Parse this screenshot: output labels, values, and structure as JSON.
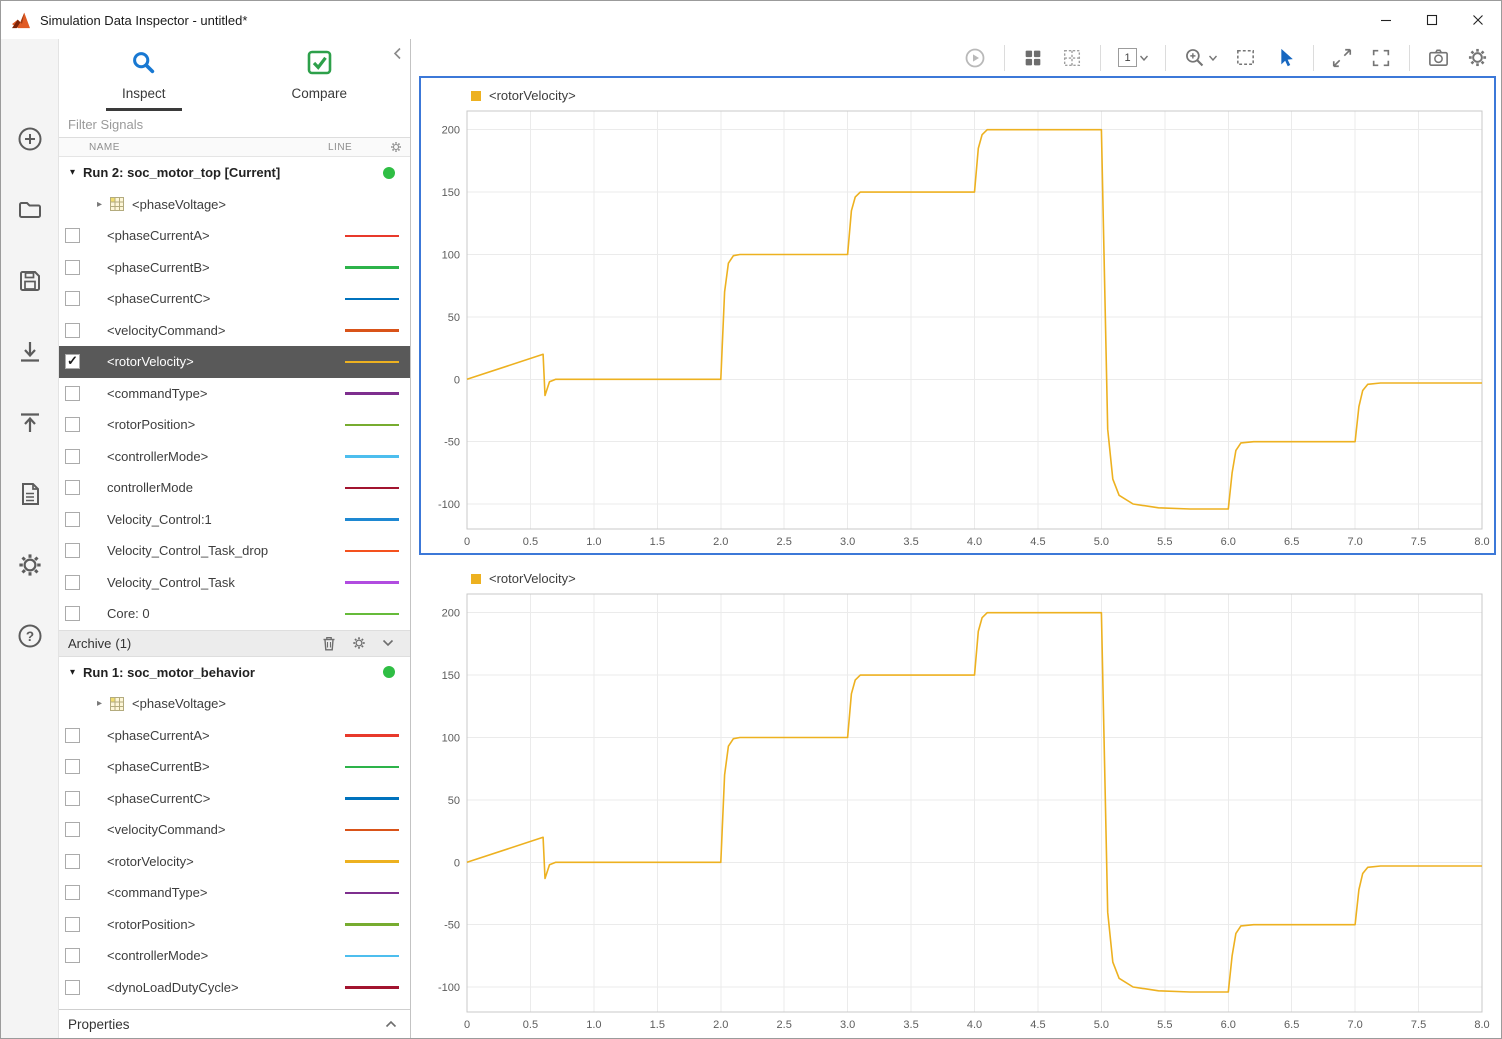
{
  "window": {
    "title": "Simulation Data Inspector - untitled*",
    "controls": [
      "minimize-icon",
      "maximize-icon",
      "close-icon"
    ]
  },
  "left_toolbar": {
    "icons": [
      "add-icon",
      "open-folder-icon",
      "save-icon",
      "import-icon",
      "export-icon",
      "report-icon",
      "preferences-gear-icon",
      "help-icon"
    ]
  },
  "sidebar": {
    "tabs": [
      {
        "label": "Inspect",
        "icon": "magnifier-icon",
        "active": true
      },
      {
        "label": "Compare",
        "icon": "green-check-icon",
        "active": false
      }
    ],
    "filter_placeholder": "Filter Signals",
    "columns": {
      "name": "NAME",
      "line": "LINE"
    },
    "runs": [
      {
        "title": "Run 2: soc_motor_top [Current]",
        "status_color": "#2fbe44",
        "children": [
          {
            "type": "group",
            "label": "<phaseVoltage>"
          },
          {
            "type": "signal",
            "label": "<phaseCurrentA>",
            "color": "#e8392b",
            "checked": false,
            "selected": false
          },
          {
            "type": "signal",
            "label": "<phaseCurrentB>",
            "color": "#2db34a",
            "checked": false,
            "selected": false
          },
          {
            "type": "signal",
            "label": "<phaseCurrentC>",
            "color": "#0072bd",
            "checked": false,
            "selected": false
          },
          {
            "type": "signal",
            "label": "<velocityCommand>",
            "color": "#d95319",
            "checked": false,
            "selected": false
          },
          {
            "type": "signal",
            "label": "<rotorVelocity>",
            "color": "#edb120",
            "checked": true,
            "selected": true
          },
          {
            "type": "signal",
            "label": "<commandType>",
            "color": "#7e2f8e",
            "checked": false,
            "selected": false
          },
          {
            "type": "signal",
            "label": "<rotorPosition>",
            "color": "#77ac30",
            "checked": false,
            "selected": false
          },
          {
            "type": "signal",
            "label": "<controllerMode>",
            "color": "#4dbeee",
            "checked": false,
            "selected": false
          },
          {
            "type": "signal",
            "label": "controllerMode",
            "color": "#a2142f",
            "checked": false,
            "selected": false
          },
          {
            "type": "signal",
            "label": "Velocity_Control:1",
            "color": "#1e88d2",
            "checked": false,
            "selected": false
          },
          {
            "type": "signal",
            "label": "Velocity_Control_Task_drop",
            "color": "#f4511e",
            "checked": false,
            "selected": false
          },
          {
            "type": "signal",
            "label": "Velocity_Control_Task",
            "color": "#b14ce0",
            "checked": false,
            "selected": false
          },
          {
            "type": "signal",
            "label": "Core: 0",
            "color": "#66bb3a",
            "checked": false,
            "selected": false
          }
        ]
      },
      {
        "title": "Run 1: soc_motor_behavior",
        "status_color": "#2fbe44",
        "children": [
          {
            "type": "group",
            "label": "<phaseVoltage>"
          },
          {
            "type": "signal",
            "label": "<phaseCurrentA>",
            "color": "#e8392b",
            "checked": false,
            "selected": false
          },
          {
            "type": "signal",
            "label": "<phaseCurrentB>",
            "color": "#2db34a",
            "checked": false,
            "selected": false
          },
          {
            "type": "signal",
            "label": "<phaseCurrentC>",
            "color": "#0072bd",
            "checked": false,
            "selected": false
          },
          {
            "type": "signal",
            "label": "<velocityCommand>",
            "color": "#d95319",
            "checked": false,
            "selected": false
          },
          {
            "type": "signal",
            "label": "<rotorVelocity>",
            "color": "#edb120",
            "checked": false,
            "selected": false
          },
          {
            "type": "signal",
            "label": "<commandType>",
            "color": "#7e2f8e",
            "checked": false,
            "selected": false
          },
          {
            "type": "signal",
            "label": "<rotorPosition>",
            "color": "#77ac30",
            "checked": false,
            "selected": false
          },
          {
            "type": "signal",
            "label": "<controllerMode>",
            "color": "#4dbeee",
            "checked": false,
            "selected": false
          },
          {
            "type": "signal",
            "label": "<dynoLoadDutyCycle>",
            "color": "#a2142f",
            "checked": false,
            "selected": false
          }
        ]
      }
    ],
    "archive": {
      "label": "Archive",
      "count": "(1)",
      "icons": [
        "trash-icon",
        "gear-icon",
        "chevron-down-icon"
      ]
    },
    "properties_label": "Properties"
  },
  "chart_toolbar": {
    "subplot_number": "1",
    "icons": [
      "replay-icon",
      "layout-grid-icon",
      "subplot-grid-icon",
      "subplot-selector",
      "zoom-icon",
      "zoom-region-icon",
      "pointer-icon",
      "fit-to-view-icon",
      "fullscreen-icon",
      "snapshot-camera-icon",
      "settings-gear-icon"
    ]
  },
  "chart_data": [
    {
      "type": "line",
      "title": "",
      "xlabel": "",
      "ylabel": "",
      "legend": [
        {
          "label": "<rotorVelocity>",
          "color": "#edb120"
        }
      ],
      "legend_position": "top-left",
      "grid": true,
      "selected": true,
      "xlim": [
        0,
        8
      ],
      "ylim": [
        -120,
        215
      ],
      "xticks": [
        0,
        0.5,
        1.0,
        1.5,
        2.0,
        2.5,
        3.0,
        3.5,
        4.0,
        4.5,
        5.0,
        5.5,
        6.0,
        6.5,
        7.0,
        7.5,
        8.0
      ],
      "yticks": [
        -100,
        -50,
        0,
        50,
        100,
        150,
        200
      ],
      "series": [
        {
          "name": "<rotorVelocity>",
          "color": "#edb120",
          "points": [
            [
              0,
              0
            ],
            [
              0.6,
              20
            ],
            [
              0.615,
              -13
            ],
            [
              0.65,
              -2
            ],
            [
              0.7,
              0
            ],
            [
              2,
              0
            ],
            [
              2.03,
              70
            ],
            [
              2.06,
              93
            ],
            [
              2.1,
              99
            ],
            [
              2.15,
              100
            ],
            [
              3,
              100
            ],
            [
              3.03,
              135
            ],
            [
              3.06,
              146
            ],
            [
              3.1,
              150
            ],
            [
              4,
              150
            ],
            [
              4.03,
              185
            ],
            [
              4.06,
              196
            ],
            [
              4.1,
              200
            ],
            [
              5,
              200
            ],
            [
              5.05,
              -40
            ],
            [
              5.09,
              -80
            ],
            [
              5.14,
              -93
            ],
            [
              5.25,
              -100
            ],
            [
              5.45,
              -103
            ],
            [
              5.7,
              -104
            ],
            [
              6,
              -104
            ],
            [
              6.03,
              -75
            ],
            [
              6.06,
              -57
            ],
            [
              6.1,
              -51
            ],
            [
              6.2,
              -50
            ],
            [
              7,
              -50
            ],
            [
              7.03,
              -22
            ],
            [
              7.06,
              -9
            ],
            [
              7.1,
              -4
            ],
            [
              7.2,
              -3
            ],
            [
              8,
              -3
            ]
          ]
        }
      ]
    },
    {
      "type": "line",
      "title": "",
      "xlabel": "",
      "ylabel": "",
      "legend": [
        {
          "label": "<rotorVelocity>",
          "color": "#edb120"
        }
      ],
      "legend_position": "top-left",
      "grid": true,
      "selected": false,
      "xlim": [
        0,
        8
      ],
      "ylim": [
        -120,
        215
      ],
      "xticks": [
        0,
        0.5,
        1.0,
        1.5,
        2.0,
        2.5,
        3.0,
        3.5,
        4.0,
        4.5,
        5.0,
        5.5,
        6.0,
        6.5,
        7.0,
        7.5,
        8.0
      ],
      "yticks": [
        -100,
        -50,
        0,
        50,
        100,
        150,
        200
      ],
      "series": [
        {
          "name": "<rotorVelocity>",
          "color": "#edb120",
          "points": [
            [
              0,
              0
            ],
            [
              0.6,
              20
            ],
            [
              0.615,
              -13
            ],
            [
              0.65,
              -2
            ],
            [
              0.7,
              0
            ],
            [
              2,
              0
            ],
            [
              2.03,
              70
            ],
            [
              2.06,
              93
            ],
            [
              2.1,
              99
            ],
            [
              2.15,
              100
            ],
            [
              3,
              100
            ],
            [
              3.03,
              135
            ],
            [
              3.06,
              146
            ],
            [
              3.1,
              150
            ],
            [
              4,
              150
            ],
            [
              4.03,
              185
            ],
            [
              4.06,
              196
            ],
            [
              4.1,
              200
            ],
            [
              5,
              200
            ],
            [
              5.05,
              -40
            ],
            [
              5.09,
              -80
            ],
            [
              5.14,
              -93
            ],
            [
              5.25,
              -100
            ],
            [
              5.45,
              -103
            ],
            [
              5.7,
              -104
            ],
            [
              6,
              -104
            ],
            [
              6.03,
              -75
            ],
            [
              6.06,
              -57
            ],
            [
              6.1,
              -51
            ],
            [
              6.2,
              -50
            ],
            [
              7,
              -50
            ],
            [
              7.03,
              -22
            ],
            [
              7.06,
              -9
            ],
            [
              7.1,
              -4
            ],
            [
              7.2,
              -3
            ],
            [
              8,
              -3
            ]
          ]
        }
      ]
    }
  ]
}
